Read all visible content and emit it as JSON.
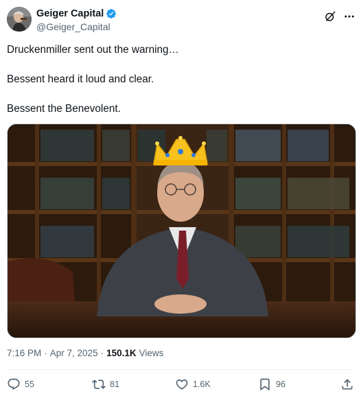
{
  "author": {
    "display_name": "Geiger Capital",
    "handle": "@Geiger_Capital"
  },
  "tweet": {
    "lines": [
      "Druckenmiller sent out the warning…",
      "Bessent heard it loud and clear.",
      "Bessent the Benevolent."
    ]
  },
  "meta": {
    "time": "7:16 PM",
    "separator": "·",
    "date": "Apr 7, 2025",
    "views_count": "150.1K",
    "views_label": "Views"
  },
  "actions": {
    "replies": "55",
    "reposts": "81",
    "likes": "1.6K",
    "bookmarks": "96"
  },
  "colors": {
    "accent": "#1d9bf0",
    "text": "#0f1419",
    "secondary": "#536471"
  },
  "icons": [
    "verified-badge-icon",
    "grok-icon",
    "more-icon",
    "reply-icon",
    "repost-icon",
    "like-icon",
    "bookmark-icon",
    "share-icon"
  ]
}
